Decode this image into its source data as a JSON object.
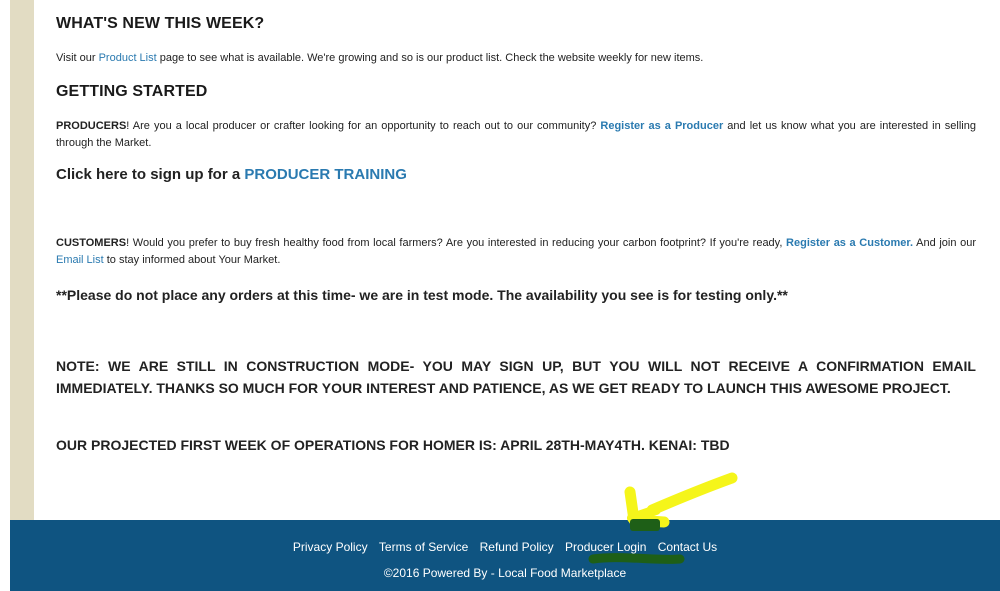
{
  "whats_new": {
    "heading": "WHAT'S NEW THIS WEEK?",
    "text_before": "Visit our ",
    "link": "Product List",
    "text_after": " page to see what is available. We're growing and so is our product list. Check the website weekly for new items."
  },
  "getting_started": {
    "heading": "GETTING STARTED",
    "producers_lead": "PRODUCERS",
    "producers_text": "! Are you a local producer or crafter looking for an opportunity to reach out to our community? ",
    "producers_link": "Register as a Producer",
    "producers_after": " and let us know what you are interested in selling through the Market.",
    "training_text": "Click here to sign up for a ",
    "training_link": "PRODUCER TRAINING",
    "customers_lead": "CUSTOMERS",
    "customers_text": "! Would you prefer to buy fresh healthy food from local farmers? Are you interested in reducing your carbon footprint? If you're ready, ",
    "customers_link": "Register as a Customer.",
    "customers_mid": " And join our ",
    "email_link": "Email List",
    "customers_after": " to stay informed about Your Market."
  },
  "notice": "**Please do not place any orders at this time- we are in test mode. The availability you see is for testing only.**",
  "note": "NOTE: WE ARE STILL IN CONSTRUCTION MODE- YOU MAY SIGN UP, BUT YOU WILL NOT RECEIVE A CONFIRMATION EMAIL IMMEDIATELY. THANKS SO MUCH FOR YOUR INTEREST AND PATIENCE, AS WE GET READY TO LAUNCH THIS AWESOME PROJECT.",
  "projected": "OUR PROJECTED FIRST WEEK OF OPERATIONS FOR HOMER IS: APRIL 28TH-MAY4TH.  KENAI: TBD",
  "footer": {
    "links": [
      "Privacy Policy",
      "Terms of Service",
      "Refund Policy",
      "Producer Login",
      "Contact Us"
    ],
    "copyright": "©2016 Powered By - Local Food Marketplace"
  },
  "colors": {
    "link": "#2a7ab0",
    "footer_bg": "#0f5481",
    "stripe": "#e2dcc3",
    "annotation_arrow": "#f5f51a",
    "annotation_underline": "#1e5f17"
  }
}
